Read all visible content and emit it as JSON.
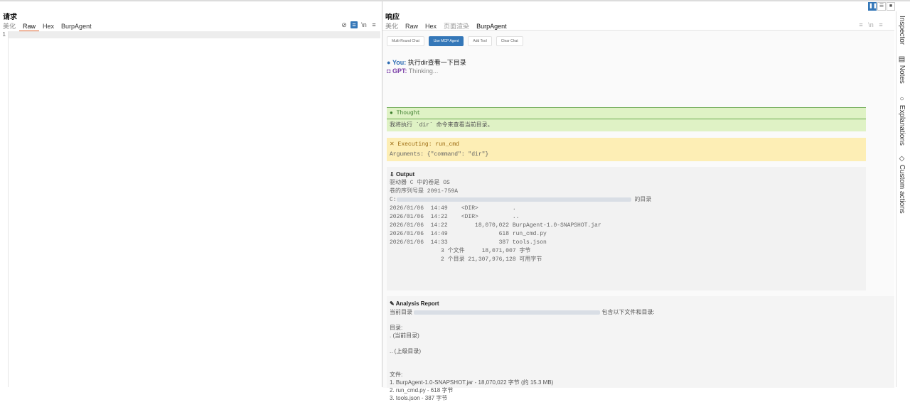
{
  "request": {
    "title": "请求",
    "tabs": [
      "美化",
      "Raw",
      "Hex",
      "BurpAgent"
    ],
    "active_tab": "Raw",
    "line_numbers": [
      "1"
    ]
  },
  "response": {
    "title": "响应",
    "tabs": [
      "美化",
      "Raw",
      "Hex",
      "页面渲染",
      "BurpAgent"
    ],
    "active_tab": "BurpAgent",
    "buttons": [
      "Multi-Round Chat",
      "Use MCP Agent",
      "Add Tool",
      "Clear Chat"
    ],
    "you_label": "You:",
    "you_text": "执行dir查看一下目录",
    "gpt_label": "GPT:",
    "gpt_text": "Thinking...",
    "thought_title": "Thought",
    "thought_text": "我将执行 `dir` 命令来查看当前目录。",
    "exec_title": "Executing: run_cmd",
    "exec_args": "Arguments: {\"command\": \"dir\"}",
    "output_title": "Output",
    "output_lines": [
      "驱动器 C 中的卷是 OS",
      "卷的序列号是 2091-759A",
      "",
      "C:",
      "",
      "2026/01/06  14:49    <DIR>          .",
      "2026/01/06  14:22    <DIR>          ..",
      "2026/01/06  14:22        18,070,022 BurpAgent-1.0-SNAPSHOT.jar",
      "2026/01/06  14:49               618 run_cmd.py",
      "2026/01/06  14:33               387 tools.json",
      "               3 个文件     18,071,007 字节",
      "               2 个目录 21,307,976,128 可用字节"
    ],
    "output_dir_suffix": "的目录",
    "report_title": "Analysis Report",
    "report_lines": [
      "当前目录",
      "",
      "目录:",
      ". (当前目录)",
      "",
      ".. (上级目录)",
      "",
      "",
      "文件:",
      "1. BurpAgent-1.0-SNAPSHOT.jar - 18,070,022 字节 (约 15.3 MB)",
      "2. run_cmd.py - 618 字节",
      "3. tools.json - 387 字节"
    ],
    "report_first_suffix": "包含以下文件和目录:"
  },
  "sidebar": {
    "items": [
      "Inspector",
      "Notes",
      "Explanations",
      "Custom actions"
    ]
  },
  "colors": {
    "accent": "#3477b8",
    "thought_bg": "#dff2c5",
    "exec_bg": "#fdeeb5"
  }
}
